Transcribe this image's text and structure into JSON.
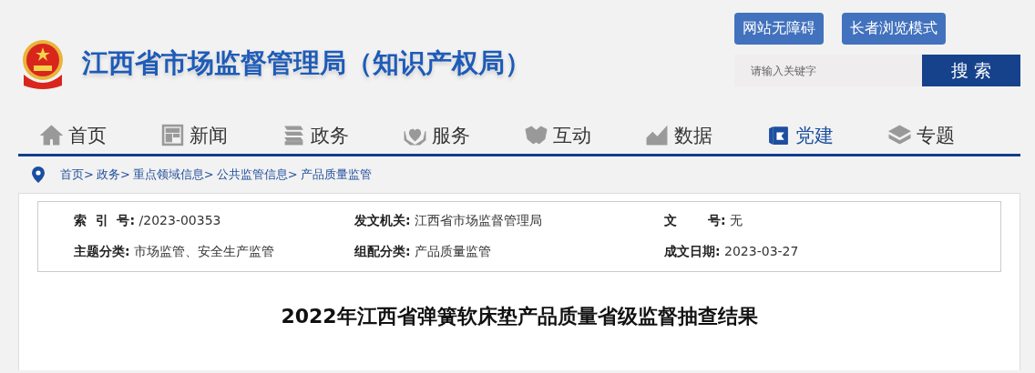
{
  "header": {
    "title": "江西省市场监督管理局（知识产权局）",
    "buttons": [
      "网站无障碍",
      "长者浏览模式"
    ],
    "search": {
      "placeholder": "请输入关键字",
      "button": "搜 索"
    }
  },
  "nav": [
    {
      "label": "首页",
      "selected": false
    },
    {
      "label": "新闻",
      "selected": false
    },
    {
      "label": "政务",
      "selected": false
    },
    {
      "label": "服务",
      "selected": false
    },
    {
      "label": "互动",
      "selected": false
    },
    {
      "label": "数据",
      "selected": false
    },
    {
      "label": "党建",
      "selected": true
    },
    {
      "label": "专题",
      "selected": false
    }
  ],
  "breadcrumb": [
    "首页>",
    "政务>",
    "重点领域信息>",
    "公共监管信息>",
    "产品质量监管"
  ],
  "info": [
    {
      "label": "索  引  号:",
      "value": "/2023-00353"
    },
    {
      "label": "发文机关:",
      "value": "江西省市场监督管理局"
    },
    {
      "label": "文       号:",
      "value": "无"
    },
    {
      "label": "主题分类:",
      "value": "市场监管、安全生产监管"
    },
    {
      "label": "组配分类:",
      "value": "产品质量监管"
    },
    {
      "label": "成文日期:",
      "value": "2023-03-27"
    }
  ],
  "article": {
    "title": "2022年江西省弹簧软床垫产品质量省级监督抽查结果"
  }
}
